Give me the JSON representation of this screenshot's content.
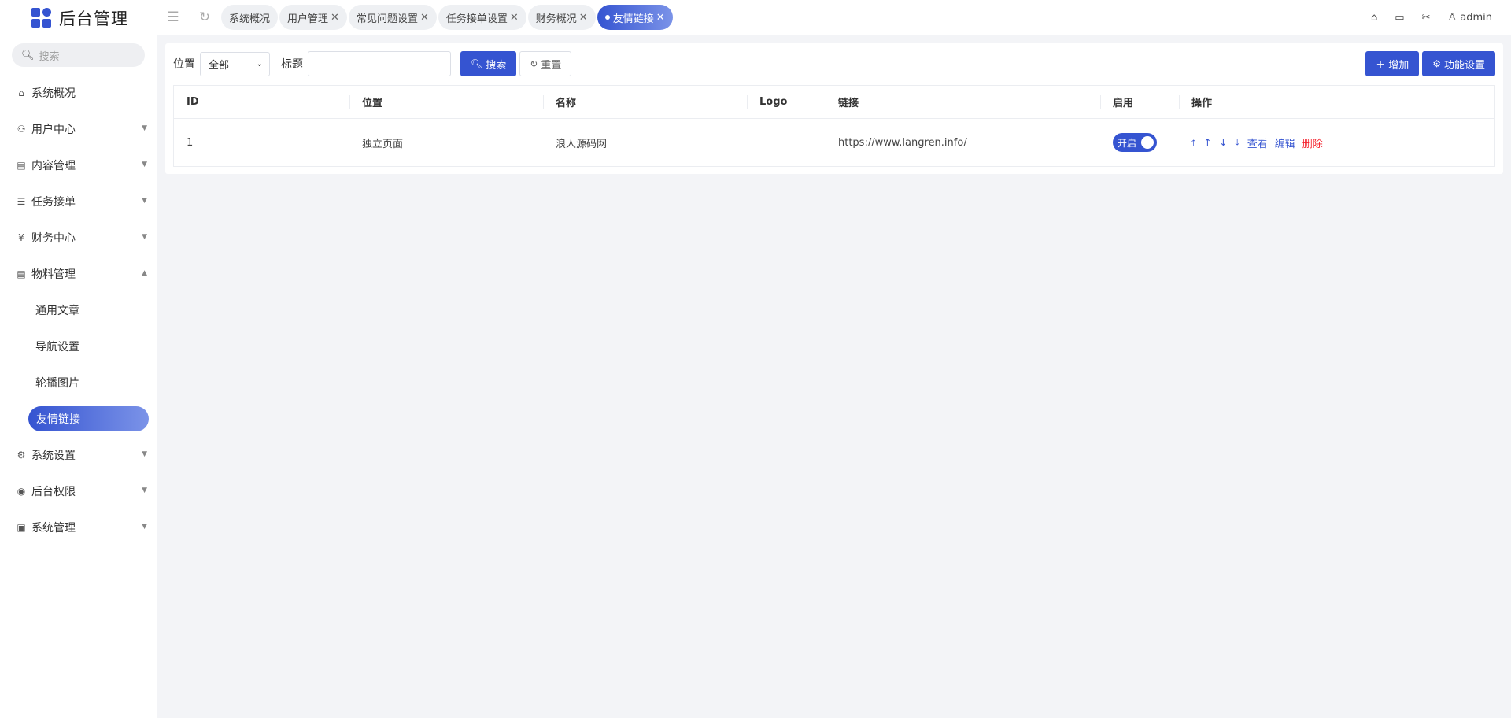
{
  "brand": {
    "title": "后台管理"
  },
  "sidebar": {
    "search_placeholder": "搜索",
    "items": [
      {
        "label": "系统概况",
        "icon": "home-icon"
      },
      {
        "label": "用户中心",
        "icon": "users-icon"
      },
      {
        "label": "内容管理",
        "icon": "document-icon"
      },
      {
        "label": "任务接单",
        "icon": "list-icon"
      },
      {
        "label": "财务中心",
        "icon": "yen-icon"
      },
      {
        "label": "物料管理",
        "icon": "document-icon"
      }
    ],
    "material_subitems": [
      {
        "label": "通用文章"
      },
      {
        "label": "导航设置"
      },
      {
        "label": "轮播图片"
      },
      {
        "label": "友情链接"
      }
    ],
    "items_bottom": [
      {
        "label": "系统设置",
        "icon": "gear-icon"
      },
      {
        "label": "后台权限",
        "icon": "user-circle-icon"
      },
      {
        "label": "系统管理",
        "icon": "image-icon"
      }
    ]
  },
  "tabs": [
    {
      "label": "系统概况"
    },
    {
      "label": "用户管理"
    },
    {
      "label": "常见问题设置"
    },
    {
      "label": "任务接单设置"
    },
    {
      "label": "财务概况"
    },
    {
      "label": "友情链接"
    }
  ],
  "topbar": {
    "user": "admin"
  },
  "filters": {
    "position_label": "位置",
    "position_value": "全部",
    "title_label": "标题",
    "title_value": "",
    "search_button": "搜索",
    "reset_button": "重置"
  },
  "actions": {
    "add_button": "增加",
    "settings_button": "功能设置"
  },
  "table": {
    "columns": [
      "ID",
      "位置",
      "名称",
      "Logo",
      "链接",
      "启用",
      "操作"
    ],
    "rows": [
      {
        "id": "1",
        "position": "独立页面",
        "name": "浪人源码网",
        "logo": "",
        "link": "https://www.langren.info/",
        "enabled": "开启"
      }
    ],
    "row_actions": {
      "view": "查看",
      "edit": "编辑",
      "delete": "删除"
    }
  }
}
